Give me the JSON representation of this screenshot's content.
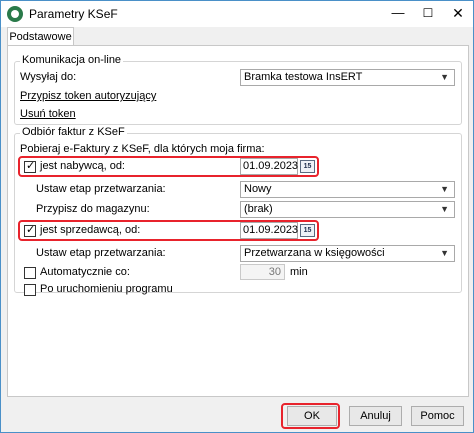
{
  "window": {
    "title": "Parametry KSeF"
  },
  "tabs": [
    {
      "label": "Podstawowe"
    }
  ],
  "online": {
    "group_label": "Komunikacja on-line",
    "send_to_label": "Wysyłaj do:",
    "send_to_value": "Bramka testowa InsERT",
    "assign_token_link": "Przypisz token autoryzujący",
    "remove_token_link": "Usuń token"
  },
  "receive": {
    "group_label": "Odbiór faktur z KSeF",
    "intro": "Pobieraj e-Faktury z KSeF, dla których moja firma:",
    "buyer": {
      "checkbox_label": "jest nabywcą, od:",
      "checked": true,
      "date": "01.09.2023",
      "stage_label": "Ustaw etap przetwarzania:",
      "stage_value": "Nowy",
      "warehouse_label": "Przypisz do magazynu:",
      "warehouse_value": "(brak)"
    },
    "seller": {
      "checkbox_label": "jest sprzedawcą, od:",
      "checked": true,
      "date": "01.09.2023",
      "stage_label": "Ustaw etap przetwarzania:",
      "stage_value": "Przetwarzana w księgowości"
    },
    "auto": {
      "label": "Automatycznie co:",
      "checked": false,
      "value": "30",
      "unit": "min"
    },
    "startup": {
      "label": "Po uruchomieniu programu",
      "checked": false
    }
  },
  "calendar_icon_text": "15",
  "buttons": {
    "ok": "OK",
    "cancel": "Anuluj",
    "help": "Pomoc"
  },
  "colors": {
    "highlight": "#e8232c",
    "window_border": "#4a90c8"
  }
}
